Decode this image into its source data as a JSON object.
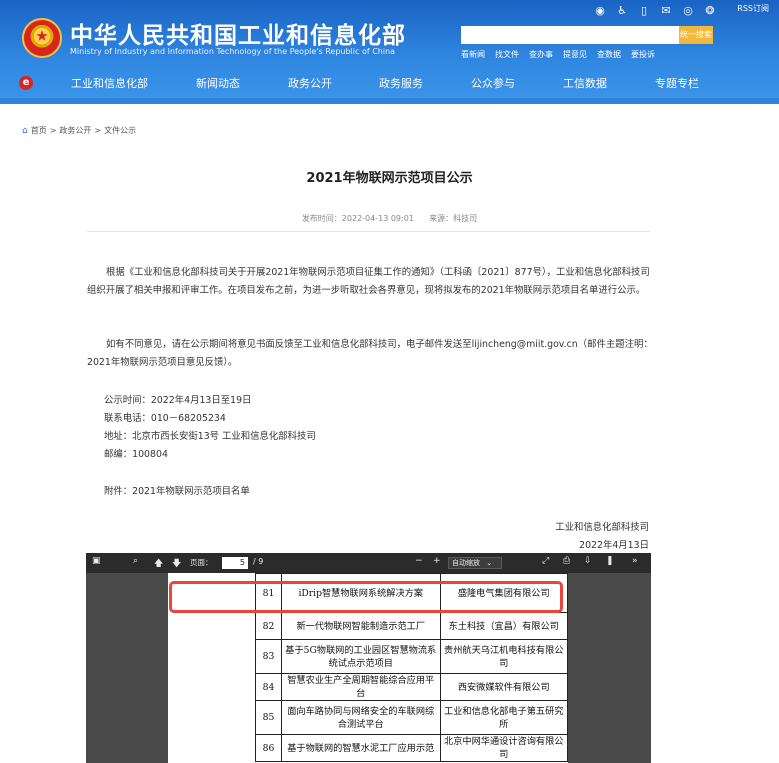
{
  "header": {
    "site_title": "中华人民共和国工业和信息化部",
    "site_subtitle": "Ministry of Industry and Information Technology of the People's Republic of China",
    "rss_label": "RSS订阅",
    "search_button": "统一搜索",
    "search_placeholder": "",
    "quick_links": [
      "看新闻",
      "找文件",
      "查办事",
      "提意见",
      "查数据",
      "要投诉"
    ],
    "top_icons": [
      "weibo-icon",
      "accessibility-icon",
      "mobile-icon",
      "mail-icon",
      "wechat-icon",
      "weibo2-icon"
    ],
    "nav": [
      "工业和信息化部",
      "新闻动态",
      "政务公开",
      "政务服务",
      "公众参与",
      "工信数据",
      "专题专栏"
    ]
  },
  "breadcrumb": {
    "items": [
      "首页",
      "政务公开",
      "文件公示"
    ],
    "separator": ">"
  },
  "article": {
    "title": "2021年物联网示范项目公示",
    "publish_time": "发布时间：2022-04-13 09:01",
    "source": "来源：科技司",
    "para1": "根据《工业和信息化部科技司关于开展2021年物联网示范项目征集工作的通知》（工科函〔2021〕877号），工业和信息化部科技司组织开展了相关申报和评审工作。在项目发布之前，为进一步听取社会各界意见，现将拟发布的2021年物联网示范项目名单进行公示。",
    "para2": "如有不同意见，请在公示期间将意见书面反馈至工业和信息化部科技司，电子邮件发送至lijincheng@miit.gov.cn（邮件主题注明：2021年物联网示范项目意见反馈）。",
    "info": [
      "公示时间：2022年4月13日至19日",
      "联系电话：010－68205234",
      "地址：北京市西长安街13号 工业和信息化部科技司",
      "邮编：100804"
    ],
    "attachment": "附件：2021年物联网示范项目名单",
    "signature_org": "工业和信息化部科技司",
    "signature_date": "2022年4月13日"
  },
  "pdf_viewer": {
    "page_label": "页面：",
    "current_page": "5",
    "total_pages": "/ 9",
    "zoom_minus": "−",
    "zoom_plus": "+",
    "zoom_label": "自动缩放",
    "rows": [
      {
        "no": "81",
        "name": "iDrip智慧物联网系统解决方案",
        "org": "盛隆电气集团有限公司"
      },
      {
        "no": "82",
        "name": "新一代物联网智能制造示范工厂",
        "org": "东土科技（宜昌）有限公司"
      },
      {
        "no": "83",
        "name": "基于5G物联网的工业园区智慧物流系统试点示范项目",
        "org": "贵州航天乌江机电科技有限公司"
      },
      {
        "no": "84",
        "name": "智慧农业生产全周期智能综合应用平台",
        "org": "西安微媒软件有限公司"
      },
      {
        "no": "85",
        "name": "面向车路协同与网络安全的车联网综合测试平台",
        "org": "工业和信息化部电子第五研究所"
      },
      {
        "no": "86",
        "name": "基于物联网的智慧水泥工厂应用示范",
        "org": "北京中网华通设计咨询有限公司"
      }
    ]
  },
  "colors": {
    "header_blue": "#2f86e0",
    "search_button": "#f0b93a",
    "highlight": "#e8453c"
  }
}
